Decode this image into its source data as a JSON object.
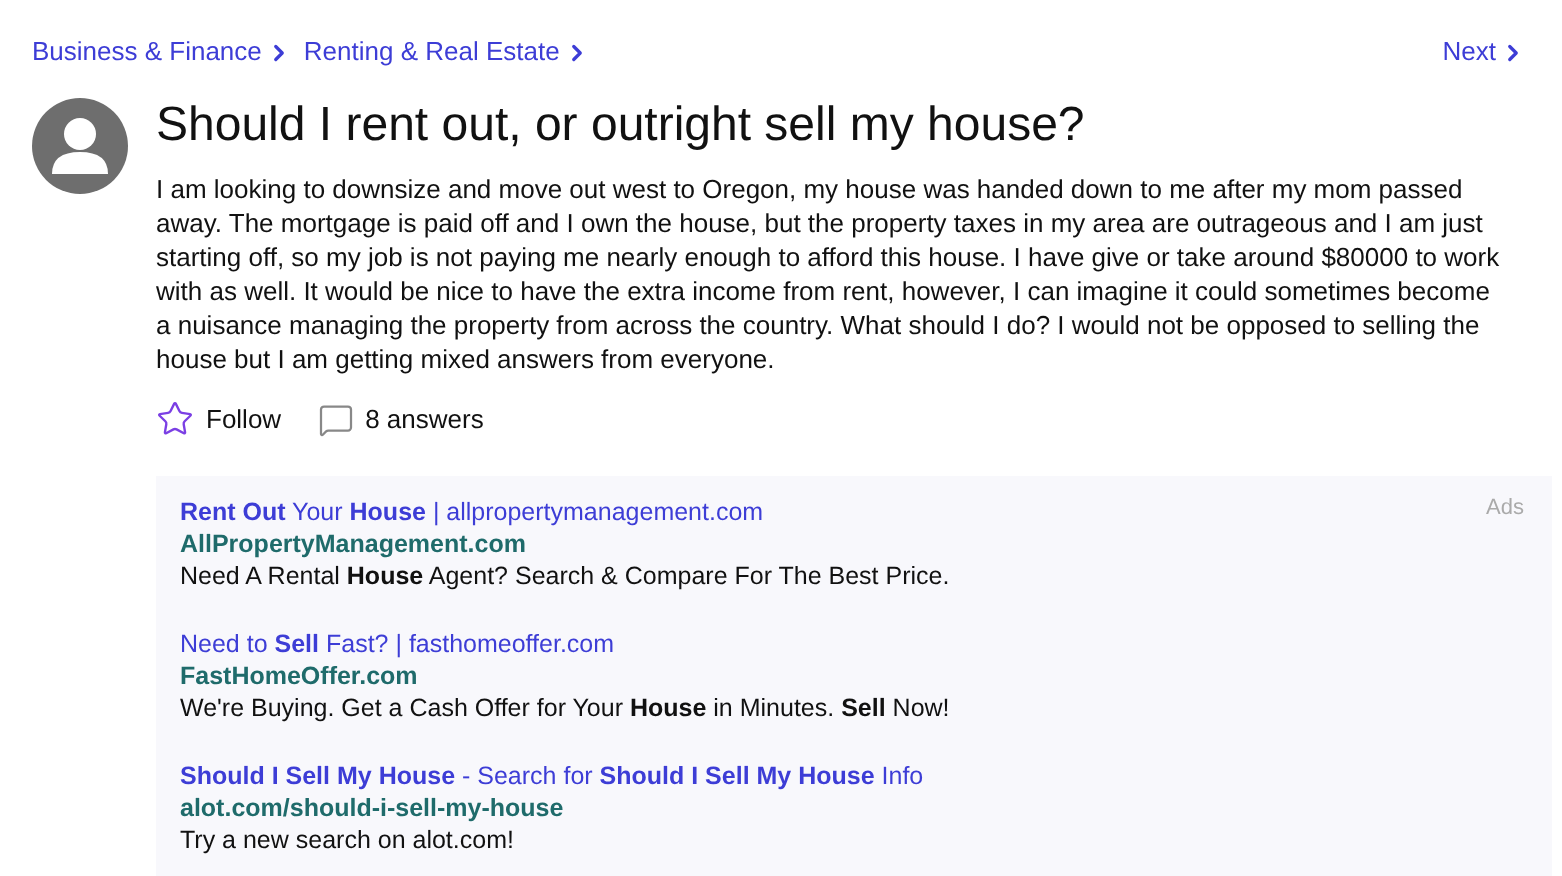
{
  "breadcrumbs": [
    {
      "label": "Business & Finance"
    },
    {
      "label": "Renting & Real Estate"
    }
  ],
  "next": {
    "label": "Next"
  },
  "question": {
    "title": "Should I rent out, or outright sell my house?",
    "body": "I am looking to downsize and move out west to Oregon, my house was handed down to me after my mom passed away. The mortgage is paid off and I own the house, but the property taxes in my area are outrageous and I am just starting off, so my job is not paying me nearly enough to afford this house. I have give or take around $80000 to work with as well. It would be nice to have the extra income from rent, however, I can imagine it could sometimes become a nuisance managing the property from across the country. What should I do? I would not be opposed to selling the house but I am getting mixed answers from everyone.",
    "follow": {
      "label": "Follow",
      "followed": false
    },
    "answers": "8 answers"
  },
  "ads": {
    "label": "Ads",
    "items": [
      {
        "title": "**Rent Out** Your **House** | allpropertymanagement.com",
        "url": "AllPropertyManagement.com",
        "description": "Need A Rental **House** Agent? Search & Compare For The Best Price."
      },
      {
        "title": "Need to **Sell** Fast? | fasthomeoffer.com",
        "url": "FastHomeOffer.com",
        "description": "We're Buying. Get a Cash Offer for Your **House** in Minutes. **Sell** Now!"
      },
      {
        "title": "**Should I Sell My House** - Search for **Should I Sell My House** Info",
        "url": "alot.com/should-i-sell-my-house",
        "description": "Try a new search on alot.com!"
      }
    ]
  }
}
